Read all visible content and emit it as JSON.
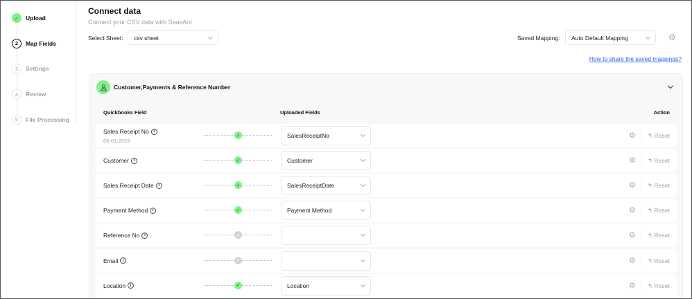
{
  "steps": [
    {
      "num": "✓",
      "label": "Upload",
      "state": "done"
    },
    {
      "num": "2",
      "label": "Map Fields",
      "state": "active"
    },
    {
      "num": "3",
      "label": "Settings",
      "state": "todo"
    },
    {
      "num": "4",
      "label": "Review",
      "state": "todo"
    },
    {
      "num": "5",
      "label": "File Processing",
      "state": "todo"
    }
  ],
  "header": {
    "title": "Connect data",
    "subtitle": "Connect your CSV data with SaasAnt"
  },
  "sheet": {
    "label": "Select Sheet:",
    "value": "csv sheet"
  },
  "mapping": {
    "label": "Saved Mapping:",
    "value": "Auto Default Mapping",
    "link": "How to share the saved mappings?"
  },
  "card": {
    "title": "Customer,Payments & Reference Number",
    "col_qb": "Quickbooks Field",
    "col_up": "Uploaded Fields",
    "col_action": "Action"
  },
  "rows": [
    {
      "field": "Sales Receipt No",
      "sample": "06-01-2023",
      "value": "SalesReceiptNo",
      "mapped": true
    },
    {
      "field": "Customer",
      "value": "Customer",
      "mapped": true
    },
    {
      "field": "Sales Receipt Date",
      "value": "SalesReceiptDate",
      "mapped": true
    },
    {
      "field": "Payment Method",
      "value": "Payment Method",
      "mapped": true
    },
    {
      "field": "Reference No",
      "value": "",
      "mapped": false
    },
    {
      "field": "Email",
      "value": "",
      "mapped": false
    },
    {
      "field": "Location",
      "value": "Location",
      "mapped": true
    }
  ],
  "reset_label": "Reset",
  "colors": {
    "accent": "#86ef8c",
    "link": "#2563eb"
  }
}
